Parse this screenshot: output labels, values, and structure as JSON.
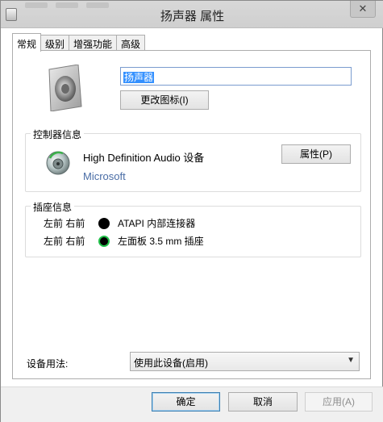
{
  "window": {
    "title": "扬声器 属性",
    "close_glyph": "✕"
  },
  "tabs": [
    {
      "label": "常规",
      "active": true
    },
    {
      "label": "级别",
      "active": false
    },
    {
      "label": "增强功能",
      "active": false
    },
    {
      "label": "高级",
      "active": false
    }
  ],
  "device": {
    "name_value": "扬声器",
    "change_icon_label": "更改图标(I)",
    "icon": "speaker-icon"
  },
  "controller": {
    "title": "控制器信息",
    "name": "High Definition Audio 设备",
    "vendor": "Microsoft",
    "properties_label": "属性(P)",
    "icon": "audio-controller-icon"
  },
  "jacks": {
    "title": "插座信息",
    "rows": [
      {
        "position": "左前 右前",
        "description": "ATAPI 内部连接器",
        "color": "#000000"
      },
      {
        "position": "左前 右前",
        "description": "左面板 3.5 mm 插座",
        "color": "#22c04a"
      }
    ]
  },
  "usage": {
    "label": "设备用法:",
    "selected": "使用此设备(启用)"
  },
  "buttons": {
    "ok": "确定",
    "cancel": "取消",
    "apply": "应用(A)"
  }
}
